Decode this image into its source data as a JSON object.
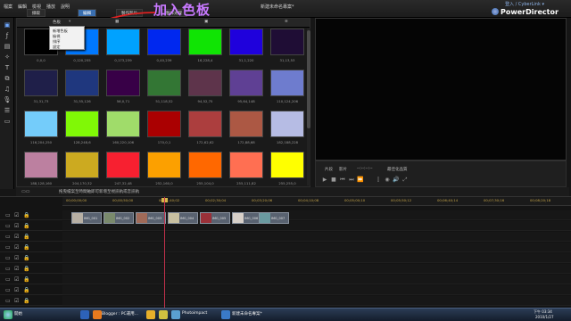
{
  "annotation": {
    "text": "加入色板"
  },
  "app": {
    "brand": "PowerDirector",
    "project_title": "新建未命名專案*",
    "user_link": "登入 / CyberLink ▾"
  },
  "menu": [
    "檔案",
    "編輯",
    "檢視",
    "播放",
    "說明"
  ],
  "mode_tabs": [
    {
      "label": "擷取"
    },
    {
      "label": "編輯",
      "active": true
    },
    {
      "label": "製作影片"
    },
    {
      "label": "製作光碟"
    }
  ],
  "library": {
    "toolbar_label": "色板",
    "context_menu": [
      "新增色板",
      "檢視",
      "排序",
      "設定"
    ],
    "swatches": [
      {
        "label": "0,0,0",
        "color": "#000000"
      },
      {
        "label": "0,120,255",
        "color": "#0078ff"
      },
      {
        "label": "0,173,239",
        "color": "#00a2ff"
      },
      {
        "label": "0,40,239",
        "color": "#0028ef"
      },
      {
        "label": "16,228,4",
        "color": "#10e404"
      },
      {
        "label": "31,1,220",
        "color": "#1f01dc"
      },
      {
        "label": "31,13,53",
        "color": "#1f0d35"
      },
      {
        "label": "31,31,73",
        "color": "#1f1f49"
      },
      {
        "label": "31,55,126",
        "color": "#1f377e"
      },
      {
        "label": "56,0,71",
        "color": "#380047"
      },
      {
        "label": "51,118,52",
        "color": "#337634"
      },
      {
        "label": "94,52,75",
        "color": "#5e344b"
      },
      {
        "label": "95,64,148",
        "color": "#5f4094"
      },
      {
        "label": "110,124,206",
        "color": "#6e7cce"
      },
      {
        "label": "116,204,250",
        "color": "#74ccfa"
      },
      {
        "label": "128,248,6",
        "color": "#80f806"
      },
      {
        "label": "160,220,106",
        "color": "#a0dc6a"
      },
      {
        "label": "170,0,1",
        "color": "#aa0001"
      },
      {
        "label": "172,62,62",
        "color": "#ac3e3e"
      },
      {
        "label": "172,88,68",
        "color": "#ac5844"
      },
      {
        "label": "182,188,228",
        "color": "#b6bce4"
      },
      {
        "label": "188,128,160",
        "color": "#bc80a0"
      },
      {
        "label": "204,170,32",
        "color": "#ccaa20"
      },
      {
        "label": "247,32,48",
        "color": "#f72030"
      },
      {
        "label": "252,160,0",
        "color": "#fca000"
      },
      {
        "label": "255,104,0",
        "color": "#ff6800"
      },
      {
        "label": "255,111,82",
        "color": "#ff6f52"
      },
      {
        "label": "255,255,0",
        "color": "#ffff00"
      }
    ]
  },
  "player": {
    "mode_clip": "片段",
    "mode_movie": "影片",
    "timecode": "--:--:--:--",
    "quality": "最佳化品質"
  },
  "status_text": "拖曳檔案至時間軸即可新增至視訊軌或音訊軌",
  "timeline": {
    "ticks": [
      "00;00;00;00",
      "00;00;50;00",
      "00;01;40;02",
      "00;02;30;04",
      "00;03;20;06",
      "00;04;10;08",
      "00;05;00;10",
      "00;05;50;12",
      "00;06;40;14",
      "00;07;30;16",
      "00;08;20;18"
    ],
    "clips": [
      {
        "name": "IMG_001",
        "thumb": "#b8b0a4"
      },
      {
        "name": "IMG_002",
        "thumb": "#7a8a6c"
      },
      {
        "name": "IMG_003",
        "thumb": "#a06a58"
      },
      {
        "name": "IMG_004",
        "thumb": "#c8c0a0"
      },
      {
        "name": "IMG_005",
        "thumb": "#9a3038"
      },
      {
        "name": "IMG_006",
        "thumb": "#d8d0c8"
      },
      {
        "name": "IMG_007",
        "thumb": "#6a9aa0"
      }
    ]
  },
  "taskbar": {
    "start": "開始",
    "items": [
      "",
      "Blogger : PC運用...",
      "",
      "",
      "Photoimpact",
      "新建未命名專案*"
    ],
    "clock_time": "下午 03:34",
    "clock_date": "2010/1/27"
  }
}
